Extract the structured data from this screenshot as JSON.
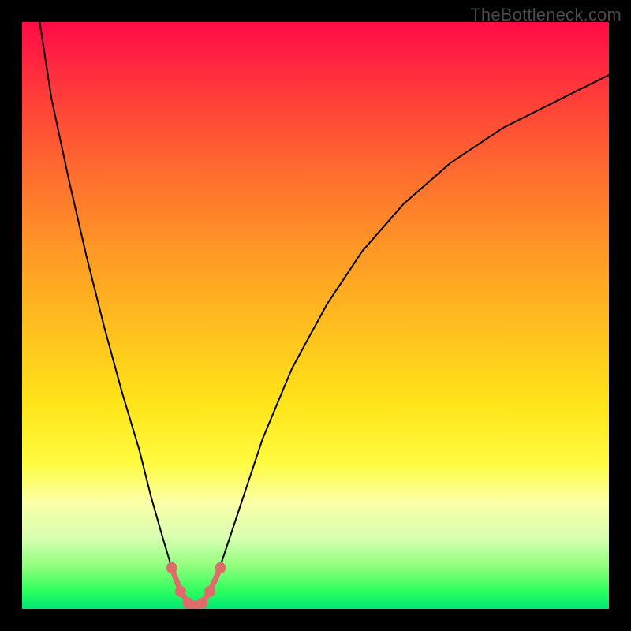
{
  "watermark": "TheBottleneck.com",
  "chart_data": {
    "type": "line",
    "title": "",
    "xlabel": "",
    "ylabel": "",
    "xlim": [
      0,
      100
    ],
    "ylim": [
      0,
      100
    ],
    "grid": false,
    "legend": false,
    "series": [
      {
        "name": "bottleneck-curve",
        "x": [
          3,
          5,
          8,
          11,
          14,
          17,
          20,
          22,
          24,
          25.5,
          27,
          28.3,
          29.3,
          30.7,
          32,
          34,
          37,
          41,
          46,
          52,
          58,
          65,
          73,
          82,
          92,
          100
        ],
        "y": [
          100,
          87,
          73,
          60,
          48,
          37,
          27,
          19,
          12,
          7,
          3,
          1,
          0.5,
          1,
          3,
          8,
          17,
          29,
          41,
          52,
          61,
          69,
          76,
          82,
          87,
          91
        ]
      }
    ],
    "markers": {
      "name": "highlight-dots",
      "color": "#e06b6b",
      "points": [
        {
          "x": 25.5,
          "y": 7
        },
        {
          "x": 27.0,
          "y": 3
        },
        {
          "x": 28.3,
          "y": 1
        },
        {
          "x": 29.3,
          "y": 0.5
        },
        {
          "x": 30.7,
          "y": 1
        },
        {
          "x": 32.0,
          "y": 3
        },
        {
          "x": 33.8,
          "y": 7
        }
      ]
    }
  }
}
